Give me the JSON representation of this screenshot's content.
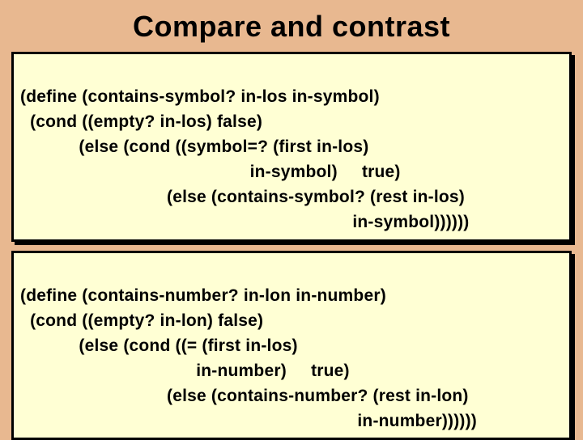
{
  "title": "Compare and contrast",
  "box1": {
    "l1": "(define (contains-symbol? in-los in-symbol)",
    "l2": "  (cond ((empty? in-los) false)",
    "l3": "            (else (cond ((symbol=? (first in-los)",
    "l4": "                                               in-symbol)     true)",
    "l5": "                              (else (contains-symbol? (rest in-los)",
    "l6": "                                                                    in-symbol))))))"
  },
  "box2": {
    "l1": "(define (contains-number? in-lon in-number)",
    "l2": "  (cond ((empty? in-lon) false)",
    "l3": "            (else (cond ((= (first in-los)",
    "l4": "                                    in-number)     true)",
    "l5": "                              (else (contains-number? (rest in-lon)",
    "l6": "                                                                     in-number))))))"
  }
}
